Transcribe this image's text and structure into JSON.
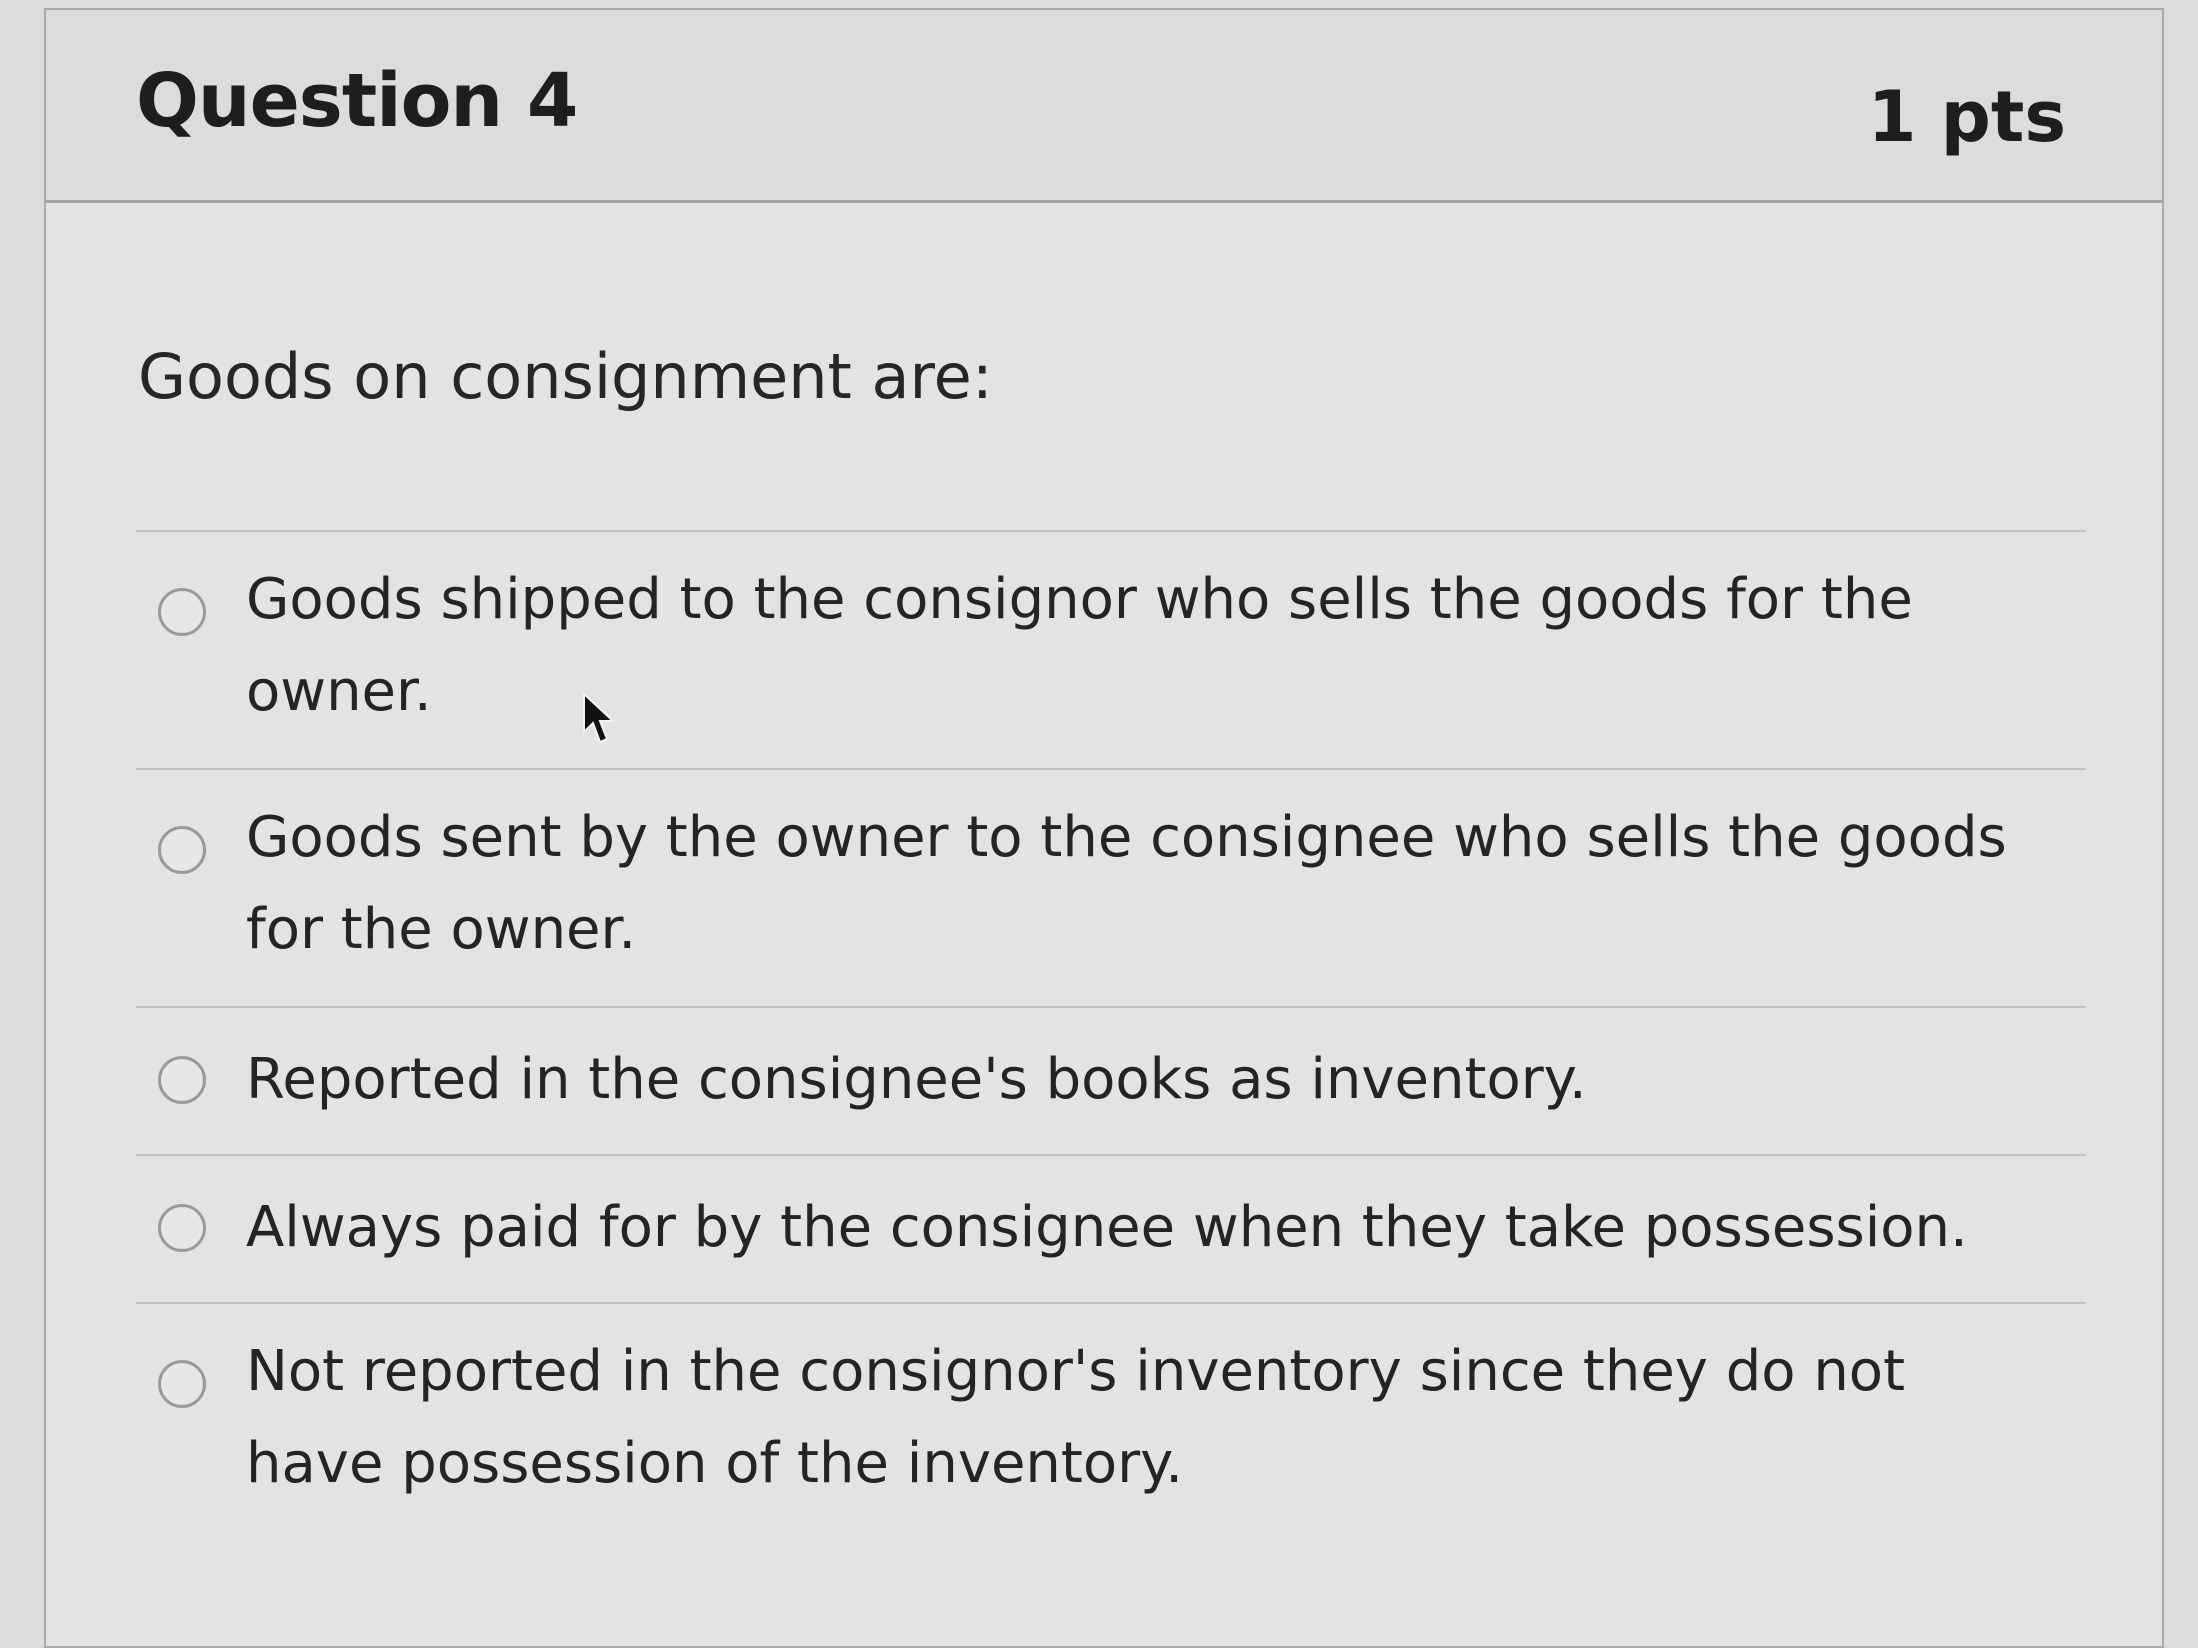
{
  "question": {
    "title": "Question 4",
    "points": "1 pts",
    "text": "Goods on consignment are:"
  },
  "answers": [
    {
      "label": "Goods shipped to the consignor who sells the goods for the owner."
    },
    {
      "label": "Goods sent by the owner to the consignee who sells the goods for the owner."
    },
    {
      "label": "Reported in the consignee's books as inventory."
    },
    {
      "label": "Always paid for by the consignee when they take possession."
    },
    {
      "label": "Not reported in the consignor's inventory since they do not have possession of the inventory."
    }
  ],
  "icons": {
    "cursor": "mouse-pointer-icon",
    "radio": "radio-button-icon"
  }
}
